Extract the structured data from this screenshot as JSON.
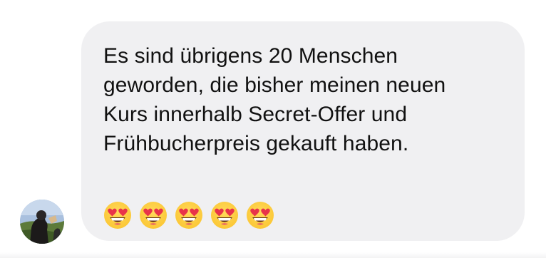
{
  "message": {
    "text": "Es sind übrigens 20 Menschen\ngeworden, die bisher meinen neuen\nKurs innerhalb Secret-Offer und\nFrühbucherpreis gekauft haben.",
    "emojis": [
      "heart-eyes-emoji",
      "heart-eyes-emoji",
      "heart-eyes-emoji",
      "heart-eyes-emoji",
      "heart-eyes-emoji"
    ],
    "emoji_count": 5
  },
  "sender": {
    "avatar_icon": "profile-photo"
  },
  "colors": {
    "bubble_background": "#f0f0f2",
    "text": "#111111",
    "emoji_face": "#fbc735",
    "emoji_heart": "#e8334a"
  }
}
